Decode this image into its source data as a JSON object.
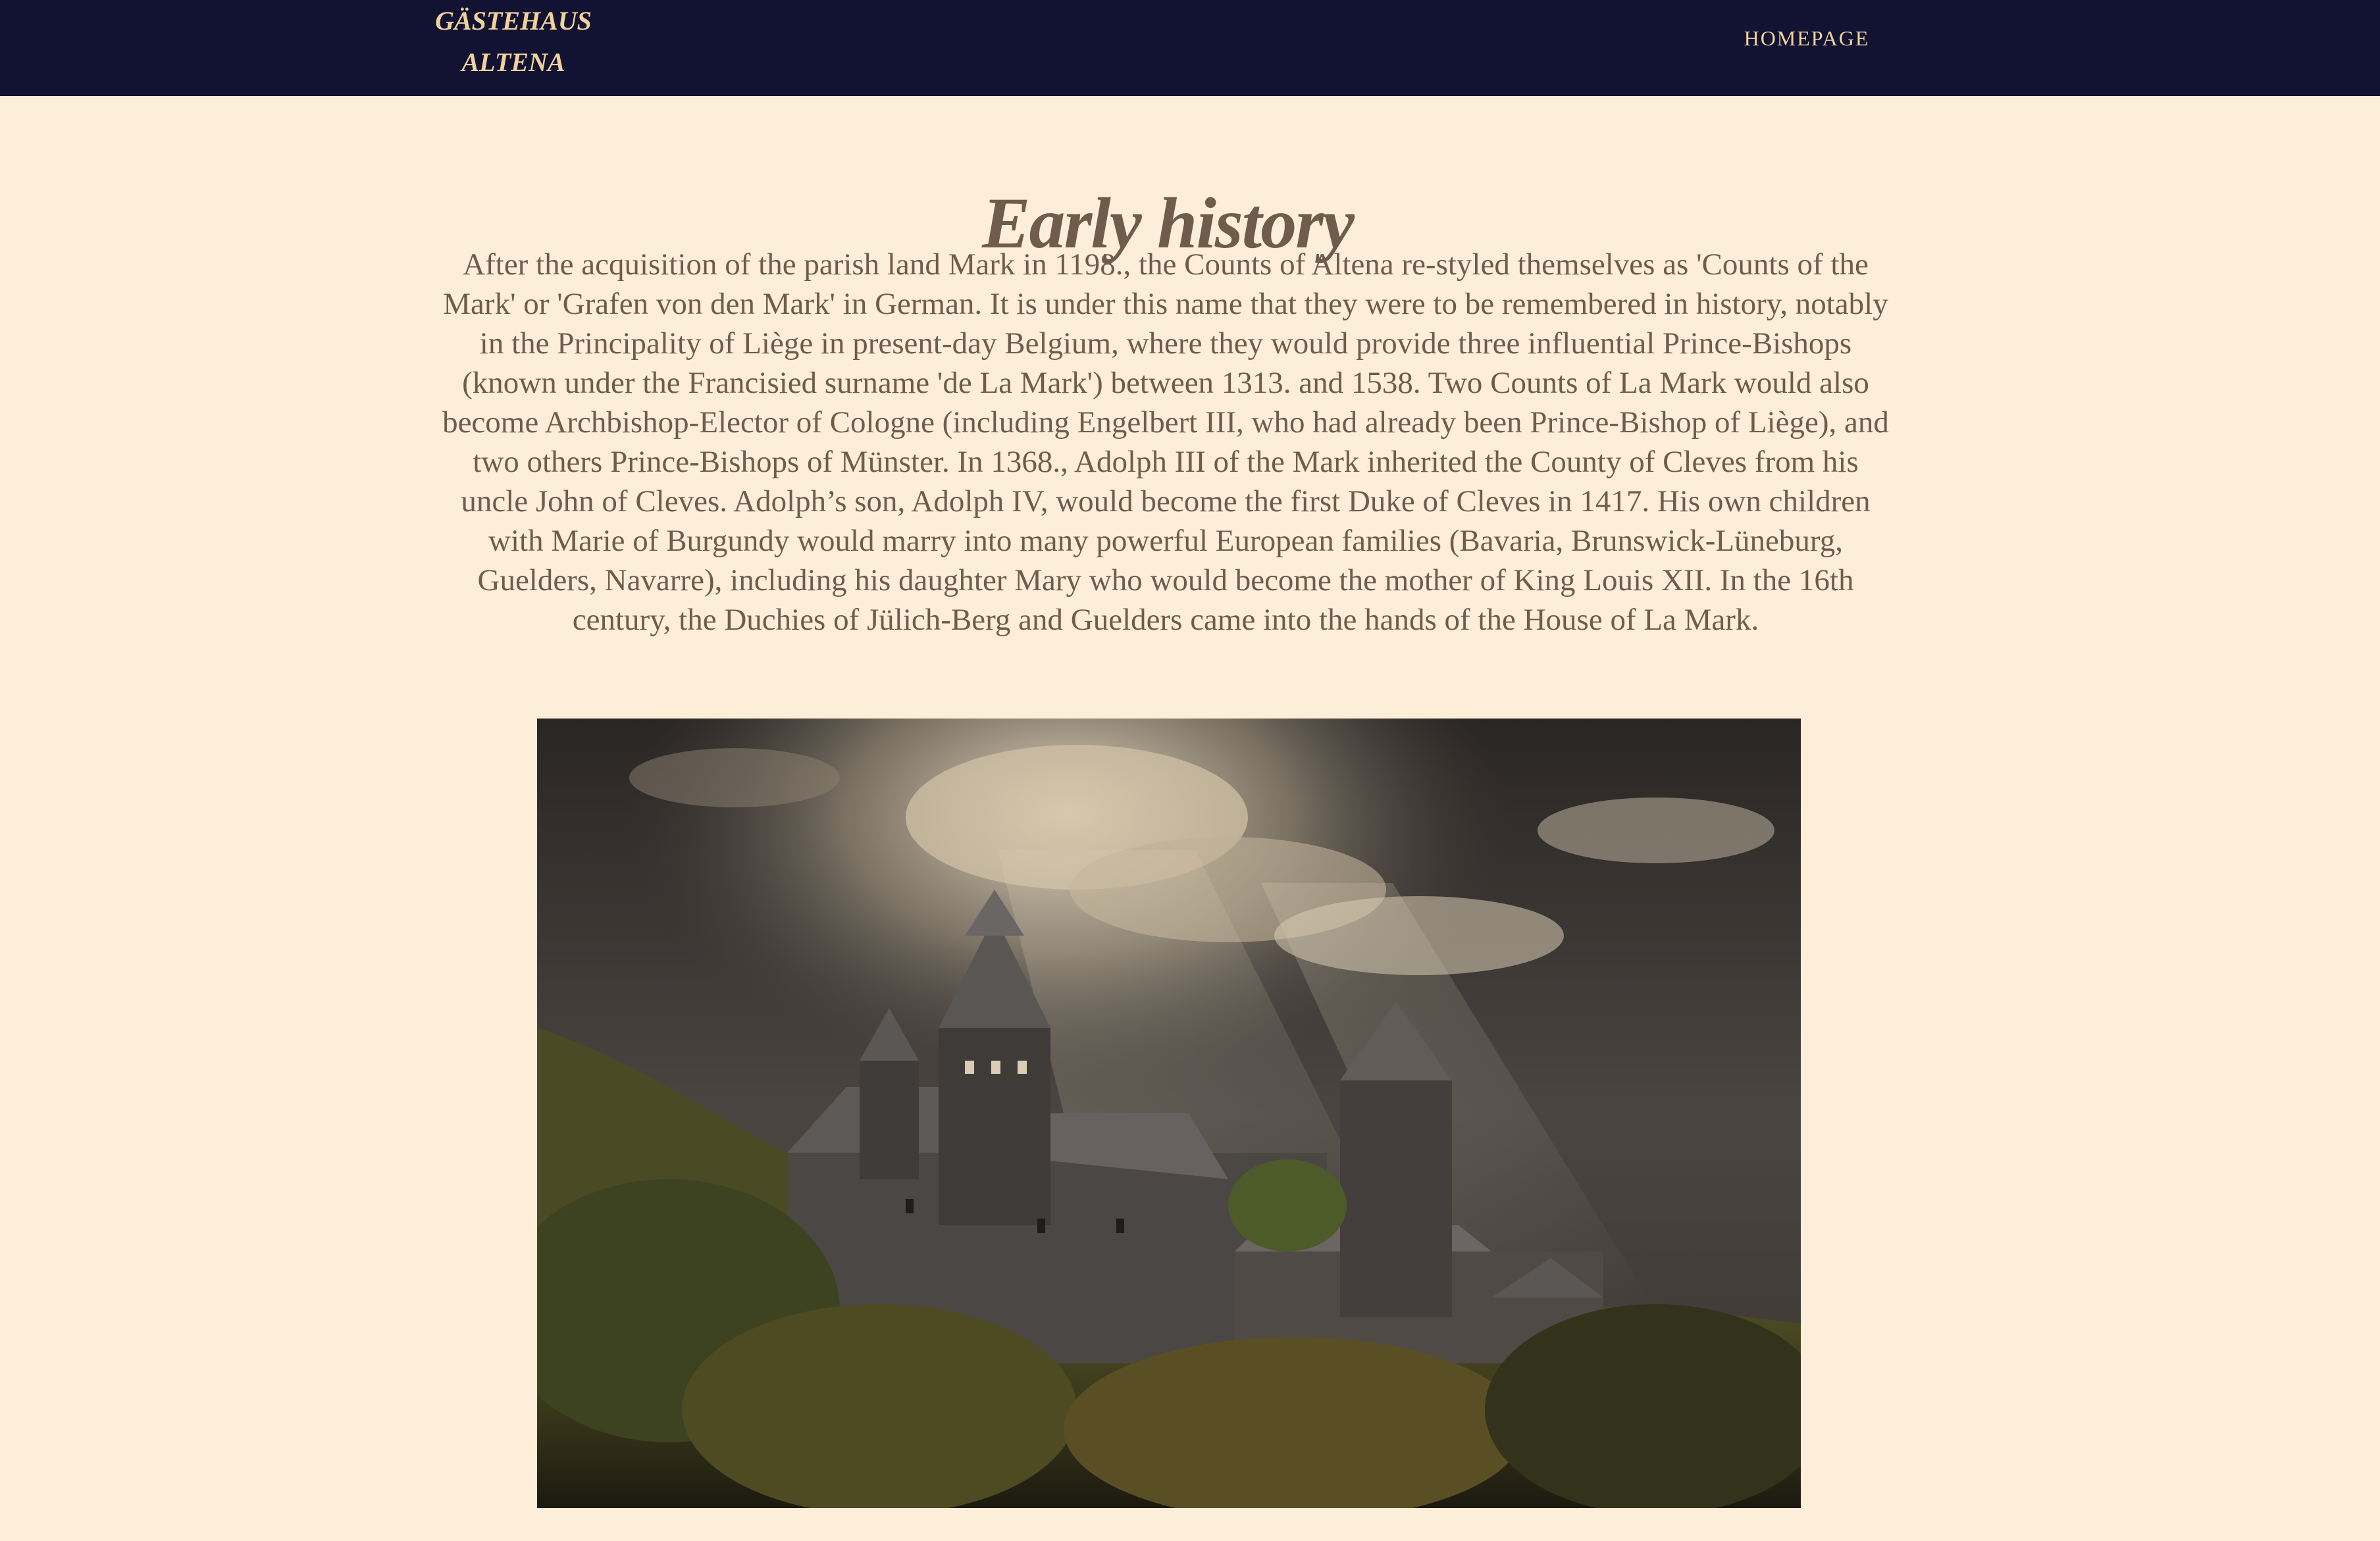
{
  "navbar": {
    "brand_line1": "GÄSTEHAUS",
    "brand_line2": "ALTENA",
    "homepage_link": "HOMEPAGE"
  },
  "main": {
    "title": "Early history",
    "paragraph": "After the acquisition of the parish land Mark in 1198., the Counts of Altena re-styled themselves as 'Counts of the Mark' or 'Grafen von den Mark' in German. It is under this name that they were to be remembered in history, notably in the Principality of Liège in present-day Belgium, where they would provide three influential Prince-Bishops (known under the Francisied surname 'de La Mark') between 1313. and 1538. Two Counts of La Mark would also become Archbishop-Elector of Cologne (including Engelbert III, who had already been Prince-Bishop of Liège), and two others Prince-Bishops of Münster. In 1368., Adolph III of the Mark inherited the County of Cleves from his uncle John of Cleves. Adolph’s son, Adolph IV, would become the first Duke of Cleves in 1417. His own children with Marie of Burgundy would marry into many powerful European families (Bavaria, Brunswick-Lüneburg, Guelders, Navarre), including his daughter Mary who would become the mother of King Louis XII. In the 16th century, the Duchies of Jülich-Berg and Guelders came into the hands of the House of La Mark."
  },
  "colors": {
    "navbar_bg": "#121233",
    "page_bg": "#fdeeda",
    "nav_text": "#f0d29a",
    "body_text": "#6f5c4a"
  }
}
